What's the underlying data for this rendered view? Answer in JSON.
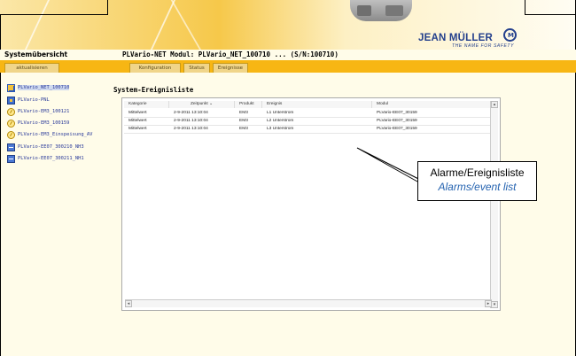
{
  "header": {
    "logo_name": "JEAN MÜLLER",
    "logo_tagline": "THE NAME FOR SAFETY",
    "system_title": "Systemübersicht",
    "module_title": "PLVario-NET Modul: PLVario_NET_100710 ... (S/N:100710)"
  },
  "toolbar": {
    "refresh_label": "aktualisieren",
    "tabs": [
      {
        "label": "Konfiguration"
      },
      {
        "label": "Status"
      },
      {
        "label": "Ereignisse"
      }
    ]
  },
  "sidebar": {
    "items": [
      {
        "label": "PLVario_NET_100710",
        "icon": "network-grid-icon",
        "selected": true
      },
      {
        "label": "PLVario-PNL",
        "icon": "panel-icon"
      },
      {
        "label": "PLVario-EM3_100121",
        "icon": "energy-meter-icon"
      },
      {
        "label": "PLVario-EM3_100159",
        "icon": "energy-meter-icon"
      },
      {
        "label": "PLVario-EM3_Einspeisung_AV",
        "icon": "energy-meter-icon"
      },
      {
        "label": "PLVario-EE07_300210_NH3",
        "icon": "switch-module-icon"
      },
      {
        "label": "PLVario-EE07_300211_NH1",
        "icon": "switch-module-icon"
      }
    ]
  },
  "main": {
    "section_title": "System-Ereignisliste",
    "table": {
      "columns": [
        "Kategorie",
        "Zeitpunkt",
        "Produkt",
        "Ereignis",
        "Modul"
      ],
      "sorted_column": "Zeitpunkt",
      "rows": [
        [
          "Mittelwert",
          "2-9-2011 13:10:04",
          "EM3",
          "L1 Unterstrom",
          "PLVario-EE07_30159"
        ],
        [
          "Mittelwert",
          "2-9-2011 13:10:04",
          "EM3",
          "L2 Unterstrom",
          "PLVario-EE07_30159"
        ],
        [
          "Mittelwert",
          "2-9-2011 13:10:04",
          "EM3",
          "L3 Unterstrom",
          "PLVario-EE07_30159"
        ]
      ]
    }
  },
  "callout": {
    "german": "Alarme/Ereignisliste",
    "english": "Alarms/event list"
  },
  "colors": {
    "toolbar": "#f7b614",
    "accent_text": "#2a3a9a",
    "callout_english": "#2563b0",
    "logo": "#233f8c"
  }
}
